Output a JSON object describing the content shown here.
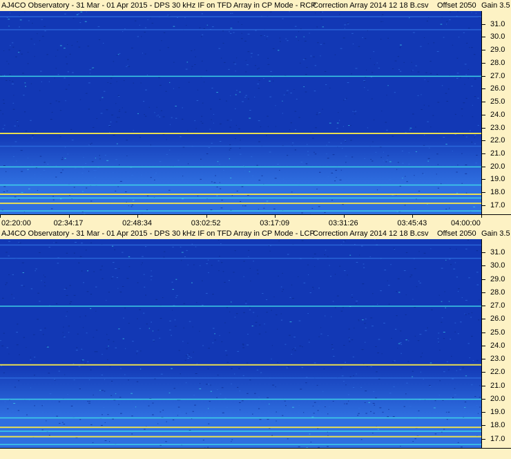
{
  "chart_data": [
    {
      "type": "heatmap",
      "title": "AJ4CO Observatory - 31 Mar - 01 Apr 2015 - DPS 30 kHz IF on TFD Array in CP Mode - RCP",
      "correction": "Correction Array 2014 12 18 B.csv",
      "offset": "Offset 2050",
      "gain": "Gain 3.5",
      "ylim": [
        16.3,
        32.0
      ],
      "y_ticks": [
        "31.0",
        "30.0",
        "29.0",
        "28.0",
        "27.0",
        "26.0",
        "25.0",
        "24.0",
        "23.0",
        "22.0",
        "21.0",
        "20.0",
        "19.0",
        "18.0",
        "17.0"
      ],
      "x_ticks": [
        "02:20:00",
        "02:34:17",
        "02:48:34",
        "03:02:52",
        "03:17:09",
        "03:31:26",
        "03:45:43",
        "04:00:00"
      ],
      "colors": {
        "background": "#1238b5",
        "low": "#0a2a8c",
        "mid": "#2f6fe0",
        "high": "#3fd6e8",
        "peak": "#f4e64a"
      },
      "bands": [
        {
          "freq": 31.6,
          "intensity": "mid"
        },
        {
          "freq": 30.6,
          "intensity": "mid"
        },
        {
          "freq": 27.0,
          "intensity": "high"
        },
        {
          "freq": 22.6,
          "intensity": "peak"
        },
        {
          "freq": 21.6,
          "intensity": "mid"
        },
        {
          "freq": 20.0,
          "intensity": "high"
        },
        {
          "freq": 18.6,
          "intensity": "high"
        },
        {
          "freq": 17.9,
          "intensity": "peak"
        },
        {
          "freq": 17.6,
          "intensity": "high"
        },
        {
          "freq": 17.2,
          "intensity": "peak"
        },
        {
          "freq": 16.6,
          "intensity": "high"
        }
      ]
    },
    {
      "type": "heatmap",
      "title": "AJ4CO Observatory - 31 Mar - 01 Apr 2015 - DPS 30 kHz IF on TFD Array in CP Mode - LCP",
      "correction": "Correction Array 2014 12 18 B.csv",
      "offset": "Offset 2050",
      "gain": "Gain 3.5",
      "ylim": [
        16.3,
        32.0
      ],
      "y_ticks": [
        "31.0",
        "30.0",
        "29.0",
        "28.0",
        "27.0",
        "26.0",
        "25.0",
        "24.0",
        "23.0",
        "22.0",
        "21.0",
        "20.0",
        "19.0",
        "18.0",
        "17.0"
      ],
      "colors": {
        "background": "#1238b5",
        "low": "#0a2a8c",
        "mid": "#2f6fe0",
        "high": "#3fd6e8",
        "peak": "#f4e64a"
      },
      "bands": [
        {
          "freq": 31.6,
          "intensity": "mid"
        },
        {
          "freq": 30.6,
          "intensity": "mid"
        },
        {
          "freq": 27.0,
          "intensity": "high"
        },
        {
          "freq": 22.6,
          "intensity": "peak"
        },
        {
          "freq": 21.6,
          "intensity": "mid"
        },
        {
          "freq": 20.0,
          "intensity": "high"
        },
        {
          "freq": 18.6,
          "intensity": "high"
        },
        {
          "freq": 17.9,
          "intensity": "peak"
        },
        {
          "freq": 17.6,
          "intensity": "high"
        },
        {
          "freq": 17.2,
          "intensity": "peak"
        },
        {
          "freq": 16.6,
          "intensity": "high"
        }
      ]
    }
  ]
}
